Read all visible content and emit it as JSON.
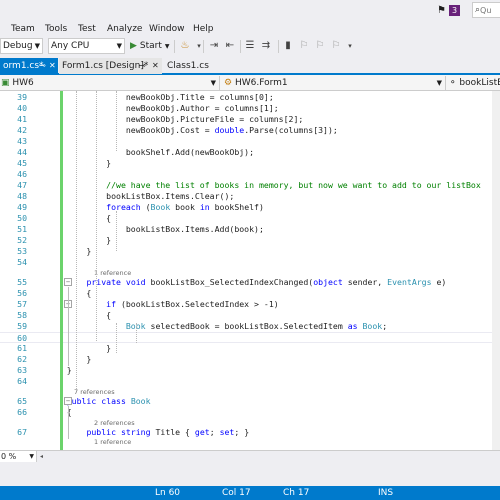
{
  "titlebar": {
    "notification_count": "3",
    "quick_launch_placeholder": "Qu"
  },
  "menu": [
    "Team",
    "Tools",
    "Test",
    "Analyze",
    "Window",
    "Help"
  ],
  "toolbar": {
    "config": "Debug",
    "platform": "Any CPU",
    "start_label": "Start"
  },
  "tabs": [
    {
      "label": "orm1.cs*",
      "state": "active"
    },
    {
      "label": "Form1.cs [Design]*",
      "state": "preview"
    },
    {
      "label": "Class1.cs",
      "state": "normal"
    }
  ],
  "navbar": {
    "project": "HW6",
    "type": "HW6.Form1",
    "member": "bookListBo"
  },
  "code": {
    "lines": [
      {
        "n": "39",
        "tokens": [
          {
            "t": "                newBookObj.Title = columns[0];",
            "c": "pl"
          }
        ]
      },
      {
        "n": "40",
        "tokens": [
          {
            "t": "                newBookObj.Author = columns[1];",
            "c": "pl"
          }
        ]
      },
      {
        "n": "41",
        "tokens": [
          {
            "t": "                newBookObj.PictureFile = columns[2];",
            "c": "pl"
          }
        ]
      },
      {
        "n": "42",
        "tokens": [
          {
            "t": "                newBookObj.Cost = ",
            "c": "pl"
          },
          {
            "t": "double",
            "c": "kw"
          },
          {
            "t": ".Parse(columns[3]);",
            "c": "pl"
          }
        ]
      },
      {
        "n": "43",
        "tokens": []
      },
      {
        "n": "44",
        "tokens": [
          {
            "t": "                bookShelf.Add(newBookObj);",
            "c": "pl"
          }
        ]
      },
      {
        "n": "45",
        "tokens": [
          {
            "t": "            }",
            "c": "pl"
          }
        ]
      },
      {
        "n": "46",
        "tokens": []
      },
      {
        "n": "47",
        "tokens": [
          {
            "t": "            //we have the list of books in memory, but now we want to add to our listBox",
            "c": "cm"
          }
        ]
      },
      {
        "n": "48",
        "tokens": [
          {
            "t": "            bookListBox.Items.Clear();",
            "c": "pl"
          }
        ]
      },
      {
        "n": "49",
        "tokens": [
          {
            "t": "            ",
            "c": "pl"
          },
          {
            "t": "foreach",
            "c": "kw"
          },
          {
            "t": " (",
            "c": "pl"
          },
          {
            "t": "Book",
            "c": "ty"
          },
          {
            "t": " book ",
            "c": "pl"
          },
          {
            "t": "in",
            "c": "kw"
          },
          {
            "t": " bookShelf)",
            "c": "pl"
          }
        ]
      },
      {
        "n": "50",
        "tokens": [
          {
            "t": "            {",
            "c": "pl"
          }
        ]
      },
      {
        "n": "51",
        "tokens": [
          {
            "t": "                bookListBox.Items.Add(book);",
            "c": "pl"
          }
        ]
      },
      {
        "n": "52",
        "tokens": [
          {
            "t": "            }",
            "c": "pl"
          }
        ]
      },
      {
        "n": "53",
        "tokens": [
          {
            "t": "        }",
            "c": "pl"
          }
        ]
      },
      {
        "n": "54",
        "tokens": []
      },
      {
        "n": "55",
        "tokens": [
          {
            "t": "        ",
            "c": "pl"
          },
          {
            "t": "private",
            "c": "kw"
          },
          {
            "t": " ",
            "c": "pl"
          },
          {
            "t": "void",
            "c": "kw"
          },
          {
            "t": " bookListBox_SelectedIndexChanged(",
            "c": "pl"
          },
          {
            "t": "object",
            "c": "kw"
          },
          {
            "t": " sender, ",
            "c": "pl"
          },
          {
            "t": "EventArgs",
            "c": "ty"
          },
          {
            "t": " e)",
            "c": "pl"
          }
        ]
      },
      {
        "n": "56",
        "tokens": [
          {
            "t": "        {",
            "c": "pl"
          }
        ]
      },
      {
        "n": "57",
        "tokens": [
          {
            "t": "            ",
            "c": "pl"
          },
          {
            "t": "if",
            "c": "kw"
          },
          {
            "t": " (bookListBox.SelectedIndex > -1)",
            "c": "pl"
          }
        ]
      },
      {
        "n": "58",
        "tokens": [
          {
            "t": "            {",
            "c": "pl"
          }
        ]
      },
      {
        "n": "59",
        "tokens": [
          {
            "t": "                ",
            "c": "pl"
          },
          {
            "t": "Book",
            "c": "ty"
          },
          {
            "t": " selectedBook = bookListBox.SelectedItem ",
            "c": "pl"
          },
          {
            "t": "as",
            "c": "kw"
          },
          {
            "t": " ",
            "c": "pl"
          },
          {
            "t": "Book",
            "c": "ty"
          },
          {
            "t": ";",
            "c": "pl"
          }
        ]
      },
      {
        "n": "60",
        "tokens": []
      },
      {
        "n": "61",
        "tokens": [
          {
            "t": "            }",
            "c": "pl"
          }
        ]
      },
      {
        "n": "62",
        "tokens": [
          {
            "t": "        }",
            "c": "pl"
          }
        ]
      },
      {
        "n": "63",
        "tokens": [
          {
            "t": "    }",
            "c": "pl"
          }
        ]
      },
      {
        "n": "64",
        "tokens": []
      },
      {
        "n": "65",
        "tokens": [
          {
            "t": "    ",
            "c": "pl"
          },
          {
            "t": "public",
            "c": "kw"
          },
          {
            "t": " ",
            "c": "pl"
          },
          {
            "t": "class",
            "c": "kw"
          },
          {
            "t": " ",
            "c": "pl"
          },
          {
            "t": "Book",
            "c": "ty"
          }
        ]
      },
      {
        "n": "66",
        "tokens": [
          {
            "t": "    {",
            "c": "pl"
          }
        ]
      },
      {
        "n": "67",
        "tokens": [
          {
            "t": "        ",
            "c": "pl"
          },
          {
            "t": "public",
            "c": "kw"
          },
          {
            "t": " ",
            "c": "pl"
          },
          {
            "t": "string",
            "c": "kw"
          },
          {
            "t": " Title { ",
            "c": "pl"
          },
          {
            "t": "get",
            "c": "kw"
          },
          {
            "t": "; ",
            "c": "pl"
          },
          {
            "t": "set",
            "c": "kw"
          },
          {
            "t": "; }",
            "c": "pl"
          }
        ]
      }
    ],
    "codelens": [
      "1 reference",
      "7 references",
      "2 references",
      "1 reference"
    ]
  },
  "zoom": "0 %",
  "statusbar": {
    "ln": "Ln 60",
    "col": "Col 17",
    "ch": "Ch 17",
    "mode": "INS"
  },
  "colors": {
    "accent": "#007acc",
    "keyword": "#0000ff",
    "type": "#2b91af",
    "comment": "#008000",
    "change_marker": "#6bd36b"
  }
}
